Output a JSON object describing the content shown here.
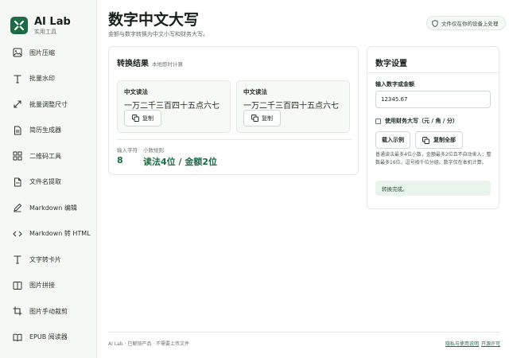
{
  "brand": {
    "name": "AI Lab",
    "subtitle": "实用工具"
  },
  "sidebar": {
    "items": [
      {
        "label": "图片压缩",
        "icon": "image-icon"
      },
      {
        "label": "批量水印",
        "icon": "text-t-icon"
      },
      {
        "label": "批量调整尺寸",
        "icon": "resize-arrows-icon"
      },
      {
        "label": "简历生成器",
        "icon": "document-icon"
      },
      {
        "label": "二维码工具",
        "icon": "grid-icon"
      },
      {
        "label": "文件名提取",
        "icon": "file-icon"
      },
      {
        "label": "Markdown 编辑",
        "icon": "pencil-icon"
      },
      {
        "label": "Markdown 转 HTML",
        "icon": "code-icon"
      },
      {
        "label": "文字转卡片",
        "icon": "text-t-icon"
      },
      {
        "label": "图片拼接",
        "icon": "columns-icon"
      },
      {
        "label": "图片手动裁剪",
        "icon": "crop-icon"
      },
      {
        "label": "EPUB 阅读器",
        "icon": "book-icon"
      }
    ]
  },
  "header": {
    "title": "数字中文大写",
    "subtitle": "金额与数字转换为中文小写和财务大写。",
    "badge": "文件仅在你的设备上处理"
  },
  "result": {
    "title": "转换结果",
    "note": "本地即时计算",
    "boxes": [
      {
        "label": "中文读法",
        "value": "一万二千三百四十五点六七",
        "copy": "复制"
      },
      {
        "label": "中文读法",
        "value": "一万二千三百四十五点六七",
        "copy": "复制"
      }
    ],
    "stats": [
      {
        "label": "输入字符",
        "value": "8"
      },
      {
        "label": "小数规则",
        "value": "读法4位 / 金额2位"
      }
    ]
  },
  "settings": {
    "title": "数字设置",
    "input_label": "输入数字或金额",
    "input_value": "12345.67",
    "checkbox_label": "使用财务大写（元 / 角 / 分）",
    "checkbox_checked": false,
    "load_example": "载入示例",
    "copy_all": "复制全部",
    "hint": "普通读法最多4位小数，金额最多2位且不自动舍入；整数最多16位，逗号按千位分组。数字仅在本机计算。",
    "status": "转换完成。"
  },
  "footer": {
    "left": "AI Lab · 已解锁产品 · 不需要上传文件",
    "link1": "隐私与使用说明",
    "sep": "·",
    "link2": "开源许可"
  },
  "colors": {
    "accent": "#1d6b45",
    "status_bg": "#e9f5ec"
  }
}
